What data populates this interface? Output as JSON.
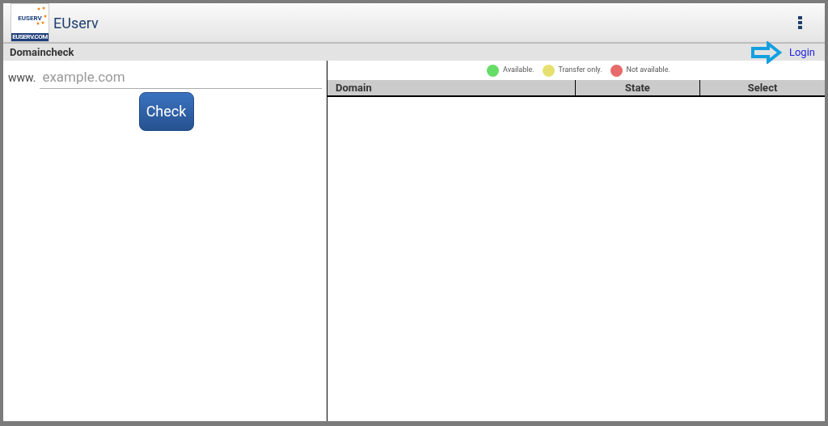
{
  "app_bar": {
    "logo": {
      "brand": "EUSERV",
      "domain": "EUSERV.COM"
    },
    "title": "EUserv"
  },
  "section": {
    "title": "Domaincheck",
    "login": "Login"
  },
  "form": {
    "prefix": "www.",
    "placeholder": "example.com",
    "button": "Check"
  },
  "legend": [
    {
      "label": "Available.",
      "color": "#66dd66"
    },
    {
      "label": "Transfer only.",
      "color": "#e6e070"
    },
    {
      "label": "Not available.",
      "color": "#e86a6a"
    }
  ],
  "table": {
    "columns": [
      "Domain",
      "State",
      "Select"
    ]
  }
}
